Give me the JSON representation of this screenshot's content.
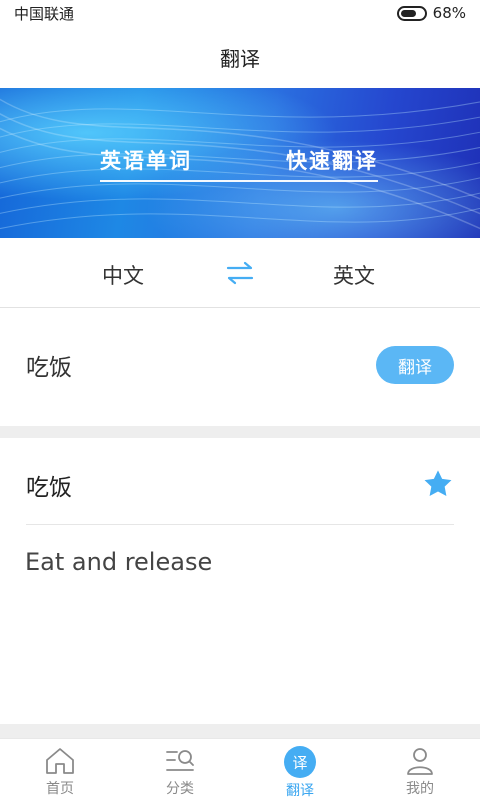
{
  "status_bar": {
    "carrier": "中国联通",
    "battery": "68%",
    "battery_level": 0.68
  },
  "header": {
    "title": "翻译"
  },
  "banner": {
    "tabs": [
      {
        "label": "英语单词"
      },
      {
        "label": "快速翻译"
      }
    ]
  },
  "language": {
    "from": "中文",
    "to": "英文"
  },
  "input": {
    "text": "吃饭",
    "translate_label": "翻译"
  },
  "result": {
    "word": "吃饭",
    "translation": "Eat and release"
  },
  "nav": {
    "items": [
      {
        "label": "首页"
      },
      {
        "label": "分类"
      },
      {
        "label": "翻译",
        "badge": "译"
      },
      {
        "label": "我的"
      }
    ]
  },
  "colors": {
    "accent": "#45adf3",
    "text": "#333333",
    "gap": "#eeeeee"
  }
}
